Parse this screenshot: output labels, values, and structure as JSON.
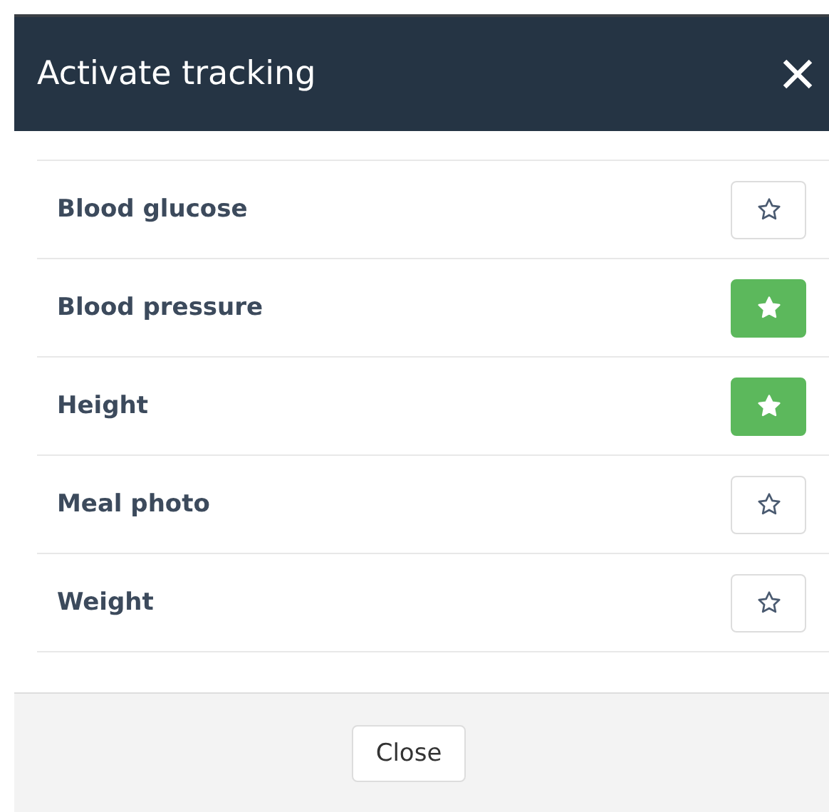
{
  "dialog": {
    "title": "Activate tracking"
  },
  "items": [
    {
      "label": "Blood glucose",
      "selected": false
    },
    {
      "label": "Blood pressure",
      "selected": true
    },
    {
      "label": "Height",
      "selected": true
    },
    {
      "label": "Meal photo",
      "selected": false
    },
    {
      "label": "Weight",
      "selected": false
    }
  ],
  "footer": {
    "button": "Close"
  }
}
